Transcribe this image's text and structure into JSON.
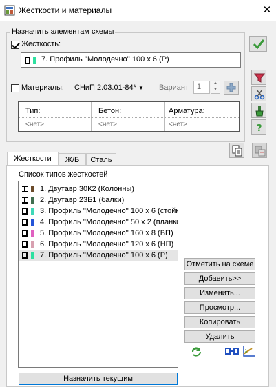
{
  "window": {
    "title": "Жесткости и материалы",
    "close": "✕"
  },
  "assign": {
    "legend": "Назначить элементам схемы",
    "stiffness_label": "Жесткость:",
    "stiffness_checked": true,
    "stiffness_value": "7. Профиль ''Молодечно'' 100 х 6 (Р)",
    "materials_label": "Материалы:",
    "materials_checked": false,
    "materials_norm": "СНиП 2.03.01-84*",
    "variant_label": "Вариант",
    "variant_value": "1",
    "table": {
      "headers": [
        "Тип:",
        "Бетон:",
        "Арматура:"
      ],
      "values": [
        "<нет>",
        "<нет>",
        "<нет>"
      ]
    }
  },
  "tabs": [
    {
      "label": "Жесткости",
      "active": true
    },
    {
      "label": "Ж/Б",
      "active": false
    },
    {
      "label": "Сталь",
      "active": false
    }
  ],
  "list": {
    "title": "Список типов жесткостей",
    "items": [
      {
        "label": "1. Двутавр 30К2 (Колонны)",
        "icon": "i-beam-icon",
        "color": "#6b4a2a",
        "selected": false
      },
      {
        "label": "2. Двутавр 23Б1 (балки)",
        "icon": "i-beam-icon",
        "color": "#3f6e4f",
        "selected": false
      },
      {
        "label": "3. Профиль ''Молодечно'' 100 х 6 (стойк",
        "icon": "box-profile-icon",
        "color": "#3fd8b8",
        "selected": false
      },
      {
        "label": "4. Профиль ''Молодечно'' 50 х 2 (планки)",
        "icon": "box-profile-icon",
        "color": "#2454d8",
        "selected": false
      },
      {
        "label": "5. Профиль ''Молодечно'' 160 х 8 (ВП)",
        "icon": "box-profile-icon",
        "color": "#e060c0",
        "selected": false
      },
      {
        "label": "6. Профиль ''Молодечно'' 120 х 6 (НП)",
        "icon": "box-profile-icon",
        "color": "#d8a0b0",
        "selected": false
      },
      {
        "label": "7. Профиль ''Молодечно'' 100 х 6 (Р)",
        "icon": "box-profile-icon",
        "color": "#2ee0a0",
        "selected": true
      }
    ]
  },
  "buttons": {
    "mark": "Отметить на схеме",
    "add": "Добавить>>",
    "edit": "Изменить...",
    "view": "Просмотр...",
    "copy": "Копировать",
    "delete": "Удалить",
    "assign_current": "Назначить текущим"
  },
  "icons": {
    "ok": "check-icon",
    "filter": "filter-icon",
    "cut": "scissors-icon",
    "brush": "brush-icon",
    "help": "help-icon",
    "copy": "copy-icon",
    "paste": "paste-icon",
    "refresh": "refresh-icon",
    "section": "section-icon",
    "axes": "axes-icon",
    "add": "plus-icon"
  },
  "colors": {
    "accent_green": "#3a9a3a",
    "selection": "#e5e5e5",
    "focus_border": "#0078d7"
  }
}
